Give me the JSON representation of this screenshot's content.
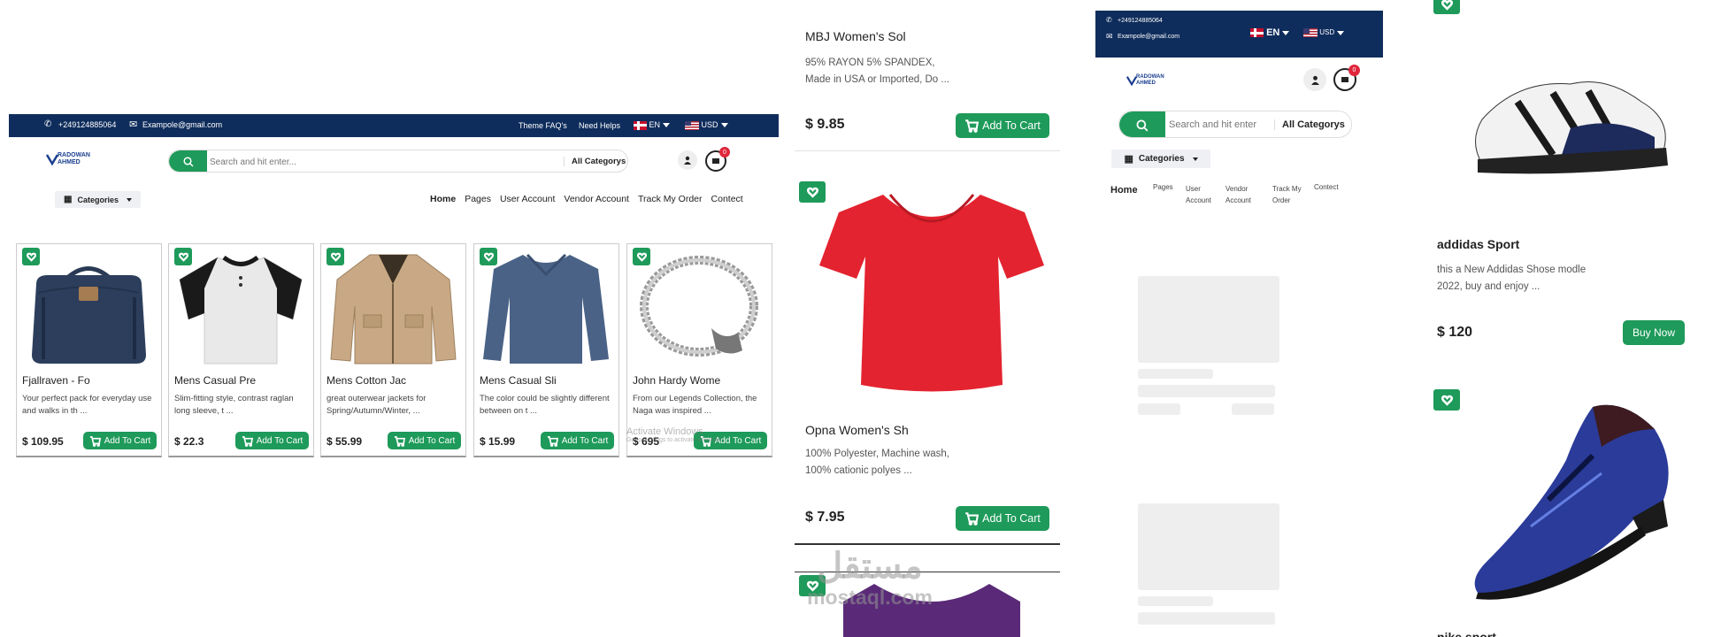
{
  "panel1": {
    "phone": "+249124885064",
    "email": "Exampole@gmail.com",
    "theme_faq": "Theme FAQ's",
    "need_helps": "Need Helps",
    "lang": "EN",
    "currency": "USD",
    "logo_line1": "RADOWAN",
    "logo_line2": "AHMED",
    "search_placeholder": "Search and hit enter...",
    "all_categorys": "All Categorys",
    "cart_count": "0",
    "categories": "Categories",
    "nav": [
      "Home",
      "Pages",
      "User Account",
      "Vendor Account",
      "Track My Order",
      "Contect"
    ],
    "products": [
      {
        "title": "Fjallraven - Fo",
        "desc": "Your perfect pack for everyday use and walks in th ...",
        "price": "$ 109.95",
        "button": "Add To Cart"
      },
      {
        "title": "Mens Casual Pre",
        "desc": "Slim-fitting style, contrast raglan long sleeve, t ...",
        "price": "$ 22.3",
        "button": "Add To Cart"
      },
      {
        "title": "Mens Cotton Jac",
        "desc": "great outerwear jackets for Spring/Autumn/Winter, ...",
        "price": "$ 55.99",
        "button": "Add To Cart"
      },
      {
        "title": "Mens Casual Sli",
        "desc": "The color could be slightly different between on t ...",
        "price": "$ 15.99",
        "button": "Add To Cart"
      },
      {
        "title": "John Hardy Wome",
        "desc": "From our Legends Collection, the Naga was inspired ...",
        "price": "$ 695",
        "button": "Add To Cart"
      }
    ],
    "watermark_line1": "Activate Windows",
    "watermark_line2": "Go to Settings to activate Windows."
  },
  "panel2": {
    "top": {
      "title": "MBJ Women's Sol",
      "desc": "95% RAYON 5% SPANDEX, Made in USA or Imported, Do ...",
      "price": "$ 9.85",
      "button": "Add To Cart"
    },
    "mid": {
      "title": "Opna Women's Sh",
      "desc": "100% Polyester, Machine wash, 100% cationic polyes ...",
      "price": "$ 7.95",
      "button": "Add To Cart"
    },
    "watermark_ar": "مستقل",
    "watermark_en": "mostaql.com"
  },
  "panel3": {
    "phone": "+249124885064",
    "email": "Exampole@gmail.com",
    "lang": "EN",
    "currency": "USD",
    "logo_line1": "RADOWAN",
    "logo_line2": "AHMED",
    "cart_count": "0",
    "search_placeholder": "Search and hit enter",
    "all_categorys": "All Categorys",
    "categories": "Categories",
    "nav": [
      "Home",
      "Pages",
      "User Account",
      "Vendor Account",
      "Track My Order",
      "Contect"
    ]
  },
  "panel4": {
    "shoe1": {
      "title": "addidas Sport",
      "desc": "this a New Addidas Shose modle 2022, buy and enjoy ...",
      "price": "$ 120",
      "button": "Buy Now"
    },
    "shoe2": {
      "title": "nike sport"
    }
  },
  "colors": {
    "green": "#1e9a5a",
    "navy": "#0f2d5c",
    "badge": "#e0263b"
  }
}
